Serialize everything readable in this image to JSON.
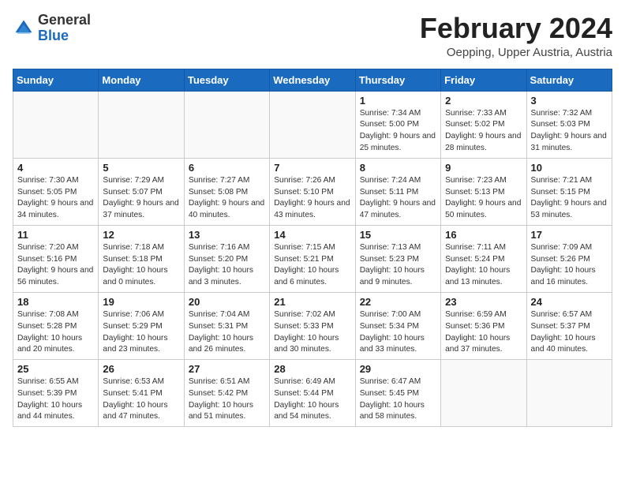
{
  "header": {
    "logo_line1": "General",
    "logo_line2": "Blue",
    "month_title": "February 2024",
    "subtitle": "Oepping, Upper Austria, Austria"
  },
  "weekdays": [
    "Sunday",
    "Monday",
    "Tuesday",
    "Wednesday",
    "Thursday",
    "Friday",
    "Saturday"
  ],
  "weeks": [
    [
      {
        "day": "",
        "info": ""
      },
      {
        "day": "",
        "info": ""
      },
      {
        "day": "",
        "info": ""
      },
      {
        "day": "",
        "info": ""
      },
      {
        "day": "1",
        "info": "Sunrise: 7:34 AM\nSunset: 5:00 PM\nDaylight: 9 hours and 25 minutes."
      },
      {
        "day": "2",
        "info": "Sunrise: 7:33 AM\nSunset: 5:02 PM\nDaylight: 9 hours and 28 minutes."
      },
      {
        "day": "3",
        "info": "Sunrise: 7:32 AM\nSunset: 5:03 PM\nDaylight: 9 hours and 31 minutes."
      }
    ],
    [
      {
        "day": "4",
        "info": "Sunrise: 7:30 AM\nSunset: 5:05 PM\nDaylight: 9 hours and 34 minutes."
      },
      {
        "day": "5",
        "info": "Sunrise: 7:29 AM\nSunset: 5:07 PM\nDaylight: 9 hours and 37 minutes."
      },
      {
        "day": "6",
        "info": "Sunrise: 7:27 AM\nSunset: 5:08 PM\nDaylight: 9 hours and 40 minutes."
      },
      {
        "day": "7",
        "info": "Sunrise: 7:26 AM\nSunset: 5:10 PM\nDaylight: 9 hours and 43 minutes."
      },
      {
        "day": "8",
        "info": "Sunrise: 7:24 AM\nSunset: 5:11 PM\nDaylight: 9 hours and 47 minutes."
      },
      {
        "day": "9",
        "info": "Sunrise: 7:23 AM\nSunset: 5:13 PM\nDaylight: 9 hours and 50 minutes."
      },
      {
        "day": "10",
        "info": "Sunrise: 7:21 AM\nSunset: 5:15 PM\nDaylight: 9 hours and 53 minutes."
      }
    ],
    [
      {
        "day": "11",
        "info": "Sunrise: 7:20 AM\nSunset: 5:16 PM\nDaylight: 9 hours and 56 minutes."
      },
      {
        "day": "12",
        "info": "Sunrise: 7:18 AM\nSunset: 5:18 PM\nDaylight: 10 hours and 0 minutes."
      },
      {
        "day": "13",
        "info": "Sunrise: 7:16 AM\nSunset: 5:20 PM\nDaylight: 10 hours and 3 minutes."
      },
      {
        "day": "14",
        "info": "Sunrise: 7:15 AM\nSunset: 5:21 PM\nDaylight: 10 hours and 6 minutes."
      },
      {
        "day": "15",
        "info": "Sunrise: 7:13 AM\nSunset: 5:23 PM\nDaylight: 10 hours and 9 minutes."
      },
      {
        "day": "16",
        "info": "Sunrise: 7:11 AM\nSunset: 5:24 PM\nDaylight: 10 hours and 13 minutes."
      },
      {
        "day": "17",
        "info": "Sunrise: 7:09 AM\nSunset: 5:26 PM\nDaylight: 10 hours and 16 minutes."
      }
    ],
    [
      {
        "day": "18",
        "info": "Sunrise: 7:08 AM\nSunset: 5:28 PM\nDaylight: 10 hours and 20 minutes."
      },
      {
        "day": "19",
        "info": "Sunrise: 7:06 AM\nSunset: 5:29 PM\nDaylight: 10 hours and 23 minutes."
      },
      {
        "day": "20",
        "info": "Sunrise: 7:04 AM\nSunset: 5:31 PM\nDaylight: 10 hours and 26 minutes."
      },
      {
        "day": "21",
        "info": "Sunrise: 7:02 AM\nSunset: 5:33 PM\nDaylight: 10 hours and 30 minutes."
      },
      {
        "day": "22",
        "info": "Sunrise: 7:00 AM\nSunset: 5:34 PM\nDaylight: 10 hours and 33 minutes."
      },
      {
        "day": "23",
        "info": "Sunrise: 6:59 AM\nSunset: 5:36 PM\nDaylight: 10 hours and 37 minutes."
      },
      {
        "day": "24",
        "info": "Sunrise: 6:57 AM\nSunset: 5:37 PM\nDaylight: 10 hours and 40 minutes."
      }
    ],
    [
      {
        "day": "25",
        "info": "Sunrise: 6:55 AM\nSunset: 5:39 PM\nDaylight: 10 hours and 44 minutes."
      },
      {
        "day": "26",
        "info": "Sunrise: 6:53 AM\nSunset: 5:41 PM\nDaylight: 10 hours and 47 minutes."
      },
      {
        "day": "27",
        "info": "Sunrise: 6:51 AM\nSunset: 5:42 PM\nDaylight: 10 hours and 51 minutes."
      },
      {
        "day": "28",
        "info": "Sunrise: 6:49 AM\nSunset: 5:44 PM\nDaylight: 10 hours and 54 minutes."
      },
      {
        "day": "29",
        "info": "Sunrise: 6:47 AM\nSunset: 5:45 PM\nDaylight: 10 hours and 58 minutes."
      },
      {
        "day": "",
        "info": ""
      },
      {
        "day": "",
        "info": ""
      }
    ]
  ]
}
